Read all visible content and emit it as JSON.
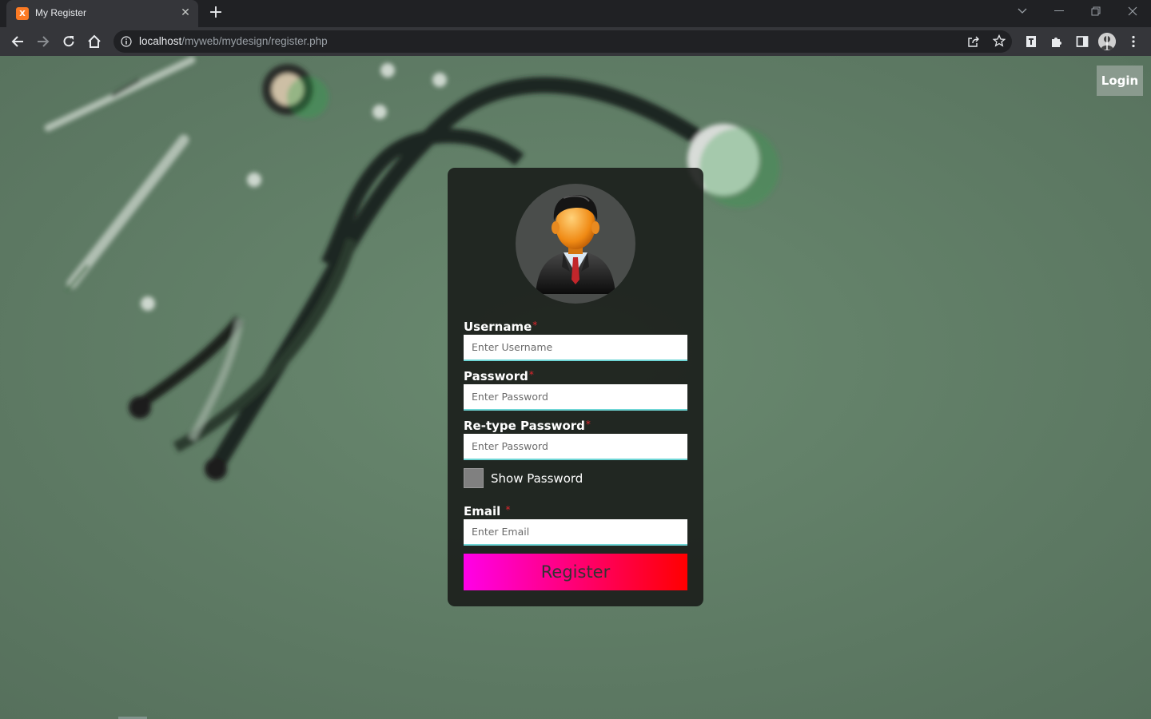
{
  "browser": {
    "tab_title": "My Register",
    "favicon_text": "X",
    "new_tab_label": "+",
    "tab_close_label": "✕",
    "url_host": "localhost",
    "url_path": "/myweb/mydesign/register.php"
  },
  "icons": [
    "close-icon",
    "plus-icon",
    "back-icon",
    "forward-icon",
    "reload-icon",
    "home-icon",
    "info-icon",
    "share-icon",
    "star-icon",
    "reader-icon",
    "extensions-icon",
    "sidebar-icon",
    "profile-icon",
    "menu-icon",
    "minimize-icon",
    "restore-icon",
    "tab-search-icon"
  ],
  "page": {
    "login_label": "Login",
    "form": {
      "username_label": "Username",
      "username_placeholder": "Enter Username",
      "password_label": "Password",
      "password_placeholder": "Enter Password",
      "retype_label": "Re-type Password",
      "retype_placeholder": "Enter Password",
      "show_password_label": "Show Password",
      "email_label": "Email",
      "email_placeholder": "Enter Email",
      "required_mark": "*",
      "register_label": "Register"
    }
  },
  "colors": {
    "page_bg": "#5c7862",
    "card_bg": "#181a18",
    "button_gradient_start": "#ff00e8",
    "button_gradient_end": "#ff0000",
    "input_underline": "#6fd6d6",
    "required": "#e0262d"
  }
}
